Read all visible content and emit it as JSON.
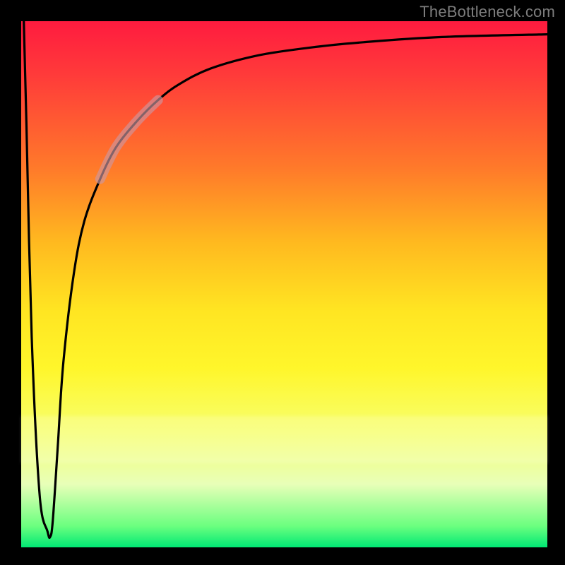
{
  "attribution": "TheBottleneck.com",
  "colors": {
    "frame": "#000000",
    "curve": "#000000",
    "highlight": "rgba(200,140,150,0.55)",
    "gradient_stops": [
      "#ff1b3f",
      "#ff3a3a",
      "#ff7a2a",
      "#ffb91f",
      "#ffe522",
      "#fff62b",
      "#f7ff6e",
      "#e8ffb8",
      "#6aff7f",
      "#00e874"
    ]
  },
  "chart_data": {
    "type": "line",
    "title": "",
    "xlabel": "",
    "ylabel": "",
    "xlim": [
      0,
      100
    ],
    "ylim": [
      0,
      100
    ],
    "grid": false,
    "series": [
      {
        "name": "bottleneck-curve",
        "x": [
          0.5,
          1,
          2,
          3.5,
          5,
          5.5,
          6,
          7,
          8,
          10,
          12,
          15,
          18,
          22,
          26,
          30,
          36,
          45,
          55,
          65,
          80,
          100
        ],
        "y": [
          100,
          80,
          40,
          10,
          3,
          2,
          5,
          20,
          35,
          52,
          62,
          70,
          76,
          81,
          85,
          88,
          91,
          93.5,
          95,
          96,
          97,
          97.5
        ]
      }
    ],
    "annotations": [
      {
        "name": "curve-highlight",
        "x_range": [
          17,
          24
        ],
        "note": "semi-transparent thick pink segment over curve"
      }
    ]
  }
}
